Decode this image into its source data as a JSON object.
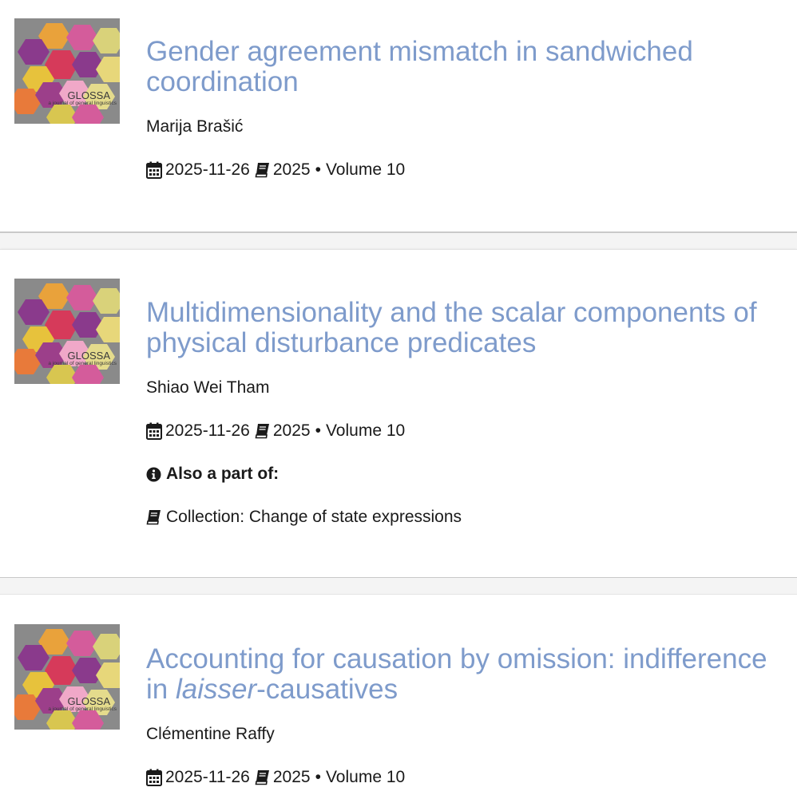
{
  "icons": {
    "calendar": "calendar-icon",
    "book": "book-icon",
    "info": "info-circle-icon"
  },
  "colors": {
    "title_link": "#7e9bcb",
    "text": "#1a1a1a"
  },
  "journal_cover": {
    "name": "GLOSSA",
    "tagline": "a journal of general linguistics"
  },
  "articles": [
    {
      "title": "Gender agreement mismatch in sandwiched coordination",
      "author": "Marija Brašić",
      "date": "2025-11-26",
      "year": "2025",
      "separator": "•",
      "volume": "Volume 10"
    },
    {
      "title": "Multidimensionality and the scalar components of physical disturbance predicates",
      "author": "Shiao Wei Tham",
      "date": "2025-11-26",
      "year": "2025",
      "separator": "•",
      "volume": "Volume 10",
      "also_part_of_label": "Also a part of:",
      "collection": "Collection: Change of state expressions"
    },
    {
      "title_part1": "Accounting for causation by omission: indifference in ",
      "title_em": "laisser",
      "title_part2": "-causatives",
      "author": "Clémentine Raffy",
      "date": "2025-11-26",
      "year": "2025",
      "separator": "•",
      "volume": "Volume 10"
    }
  ]
}
